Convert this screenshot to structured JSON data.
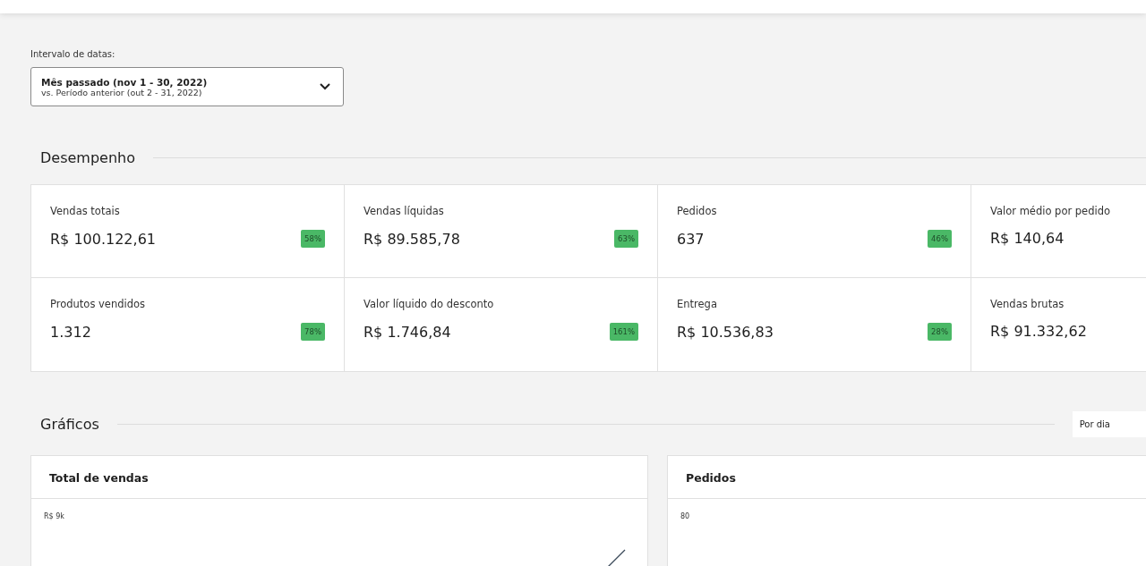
{
  "date_range": {
    "label": "Intervalo de datas:",
    "value": "Mês passado (nov 1 - 30, 2022)",
    "comparison": "vs. Período anterior (out 2 - 31, 2022)"
  },
  "performance": {
    "title": "Desempenho",
    "metrics": [
      {
        "label": "Vendas totais",
        "value": "R$ 100.122,61",
        "change": "58%"
      },
      {
        "label": "Vendas líquidas",
        "value": "R$ 89.585,78",
        "change": "63%"
      },
      {
        "label": "Pedidos",
        "value": "637",
        "change": "46%"
      },
      {
        "label": "Valor médio por pedido",
        "value": "R$ 140,64"
      },
      {
        "label": "Produtos vendidos",
        "value": "1.312",
        "change": "78%"
      },
      {
        "label": "Valor líquido do desconto",
        "value": "R$ 1.746,84",
        "change": "161%"
      },
      {
        "label": "Entrega",
        "value": "R$ 10.536,83",
        "change": "28%"
      },
      {
        "label": "Vendas brutas",
        "value": "R$ 91.332,62"
      }
    ]
  },
  "charts": {
    "title": "Gráficos",
    "interval": "Por dia",
    "panels": [
      {
        "title": "Total de vendas",
        "axis_label": "R$ 9k"
      },
      {
        "title": "Pedidos",
        "axis_label": "80"
      }
    ]
  }
}
